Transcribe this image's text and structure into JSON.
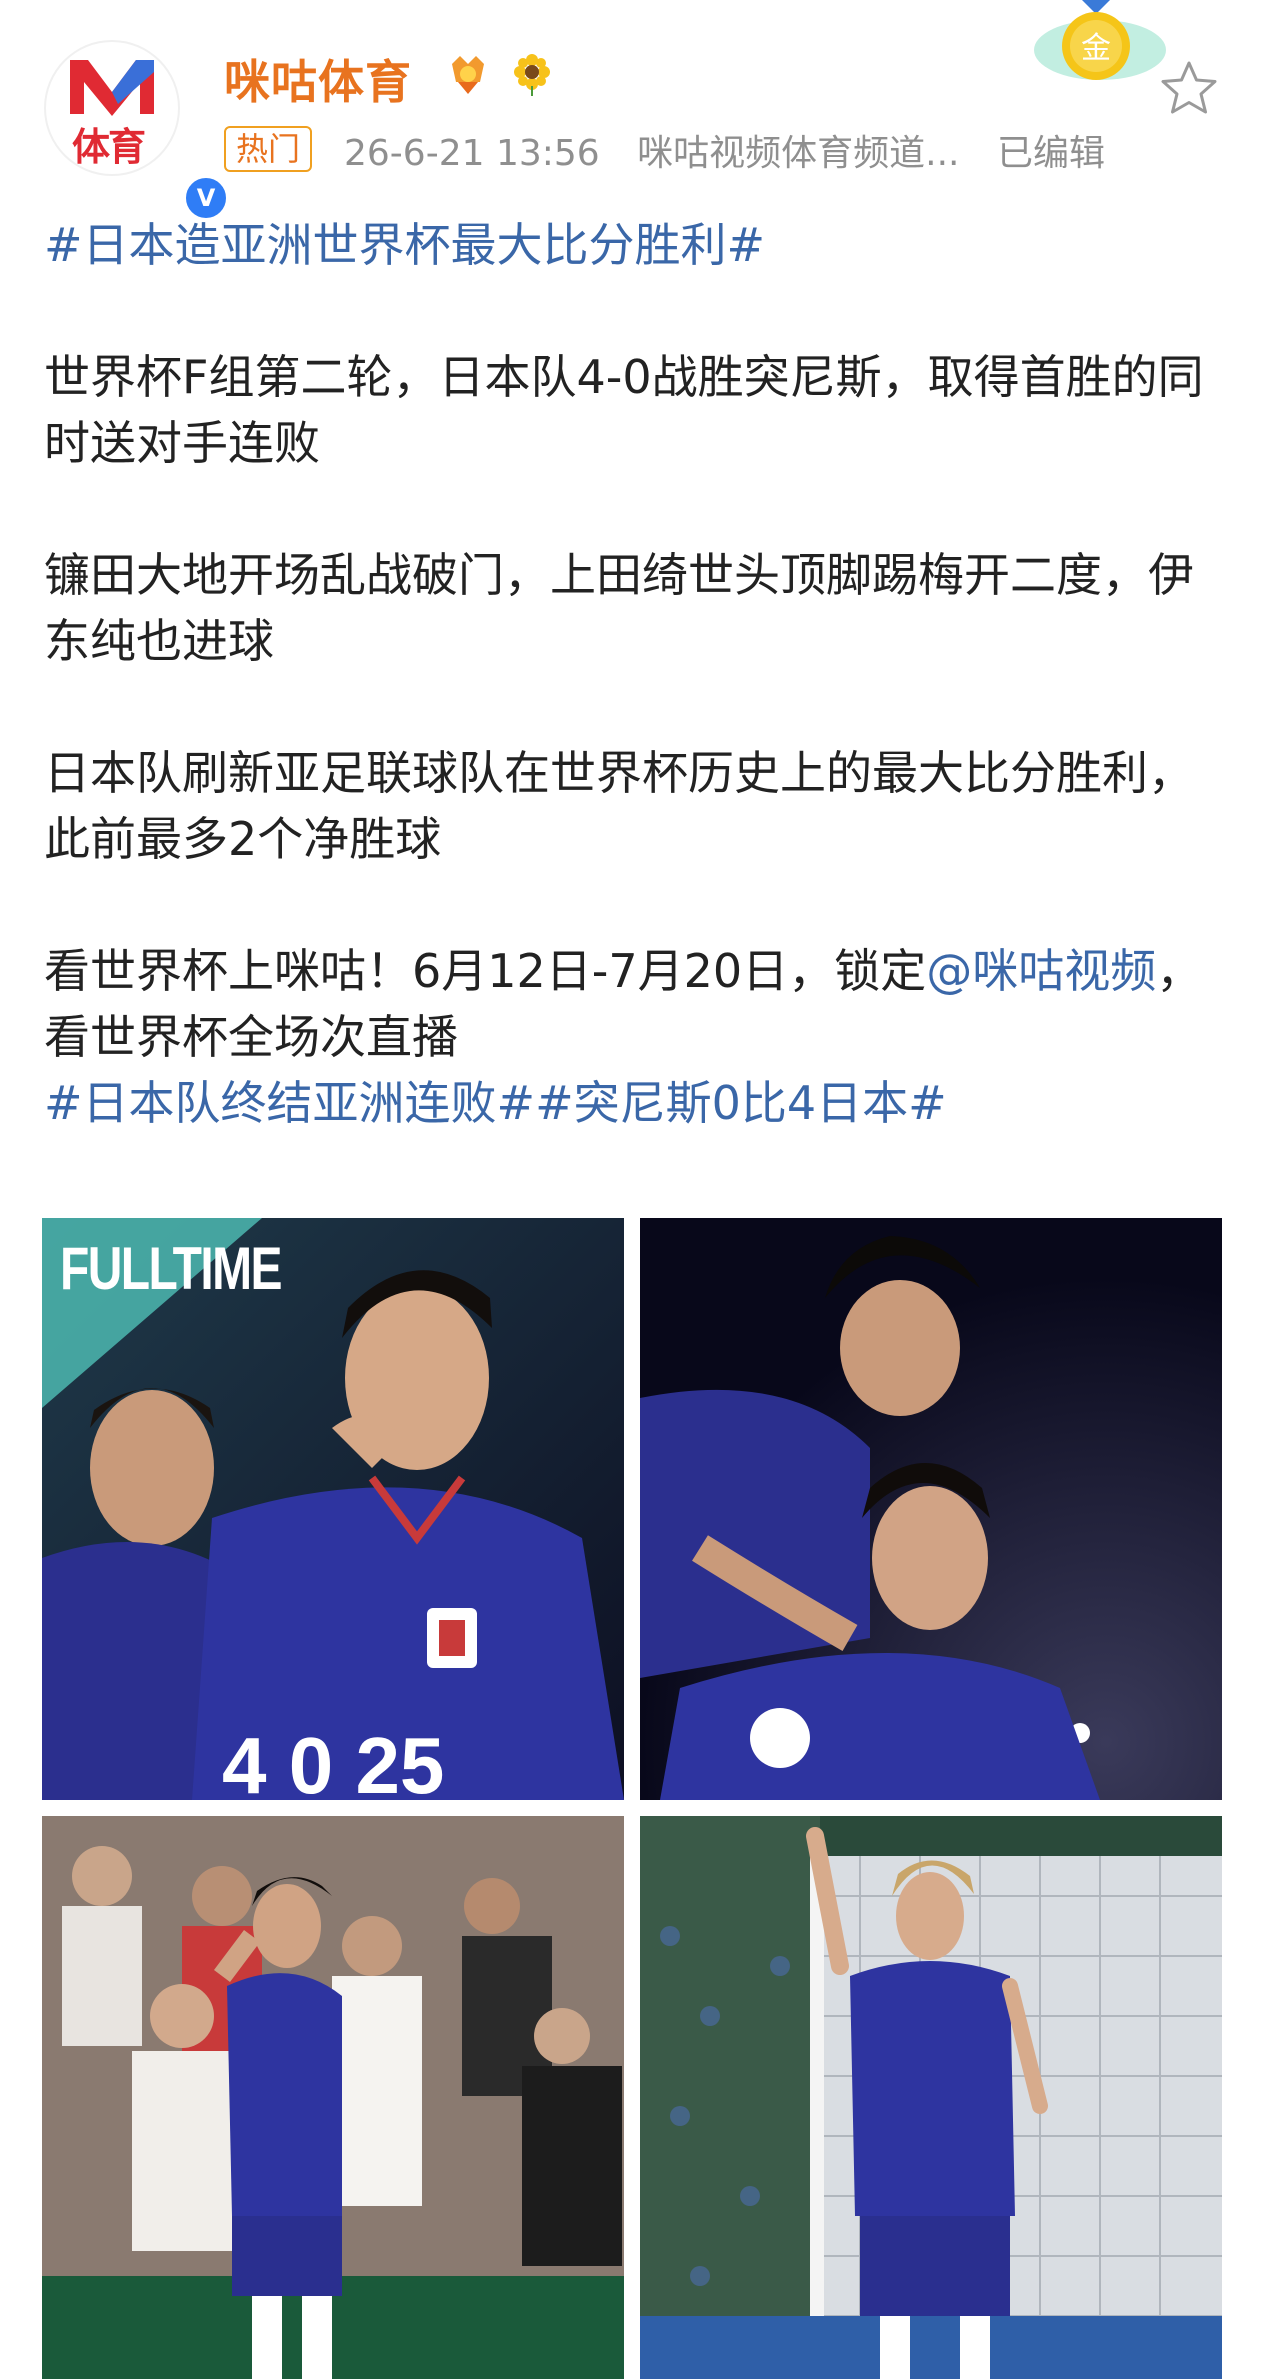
{
  "account": {
    "name": "咪咕体育",
    "avatar_text": "体育",
    "verified": "V"
  },
  "meta": {
    "hot_label": "热门",
    "timestamp": "26-6-21 13:56",
    "source": "咪咕视频体育频道...",
    "edited": "已编辑"
  },
  "gold_medal_label": "金",
  "post": {
    "headline_tag": "#日本造亚洲世界杯最大比分胜利#",
    "para1": "世界杯F组第二轮，日本队4-0战胜突尼斯，取得首胜的同时送对手连败",
    "para2": "镰田大地开场乱战破门，上田绮世头顶脚踢梅开二度，伊东纯也进球",
    "para3": "日本队刷新亚足联球队在世界杯历史上的最大比分胜利，此前最多2个净胜球",
    "para4_prefix": "看世界杯上咪咕！6月12日-7月20日，锁定",
    "para4_mention": "@咪咕视频",
    "para4_suffix": "，看世界杯全场次直播",
    "tag2": "#日本队终结亚洲连败#",
    "tag3": "#突尼斯0比4日本#"
  },
  "photos": {
    "p1_overlay": "FULLTIME",
    "p1_number": "4 0 25"
  },
  "colors": {
    "accent_orange": "#e8731f",
    "link_blue": "#3a67a8",
    "meta_gray": "#8f8f8f",
    "japan_blue": "#2a2f8f"
  },
  "icons": [
    "verified-icon",
    "award-icon",
    "sunflower-icon",
    "gold-medal-icon",
    "star-icon"
  ]
}
